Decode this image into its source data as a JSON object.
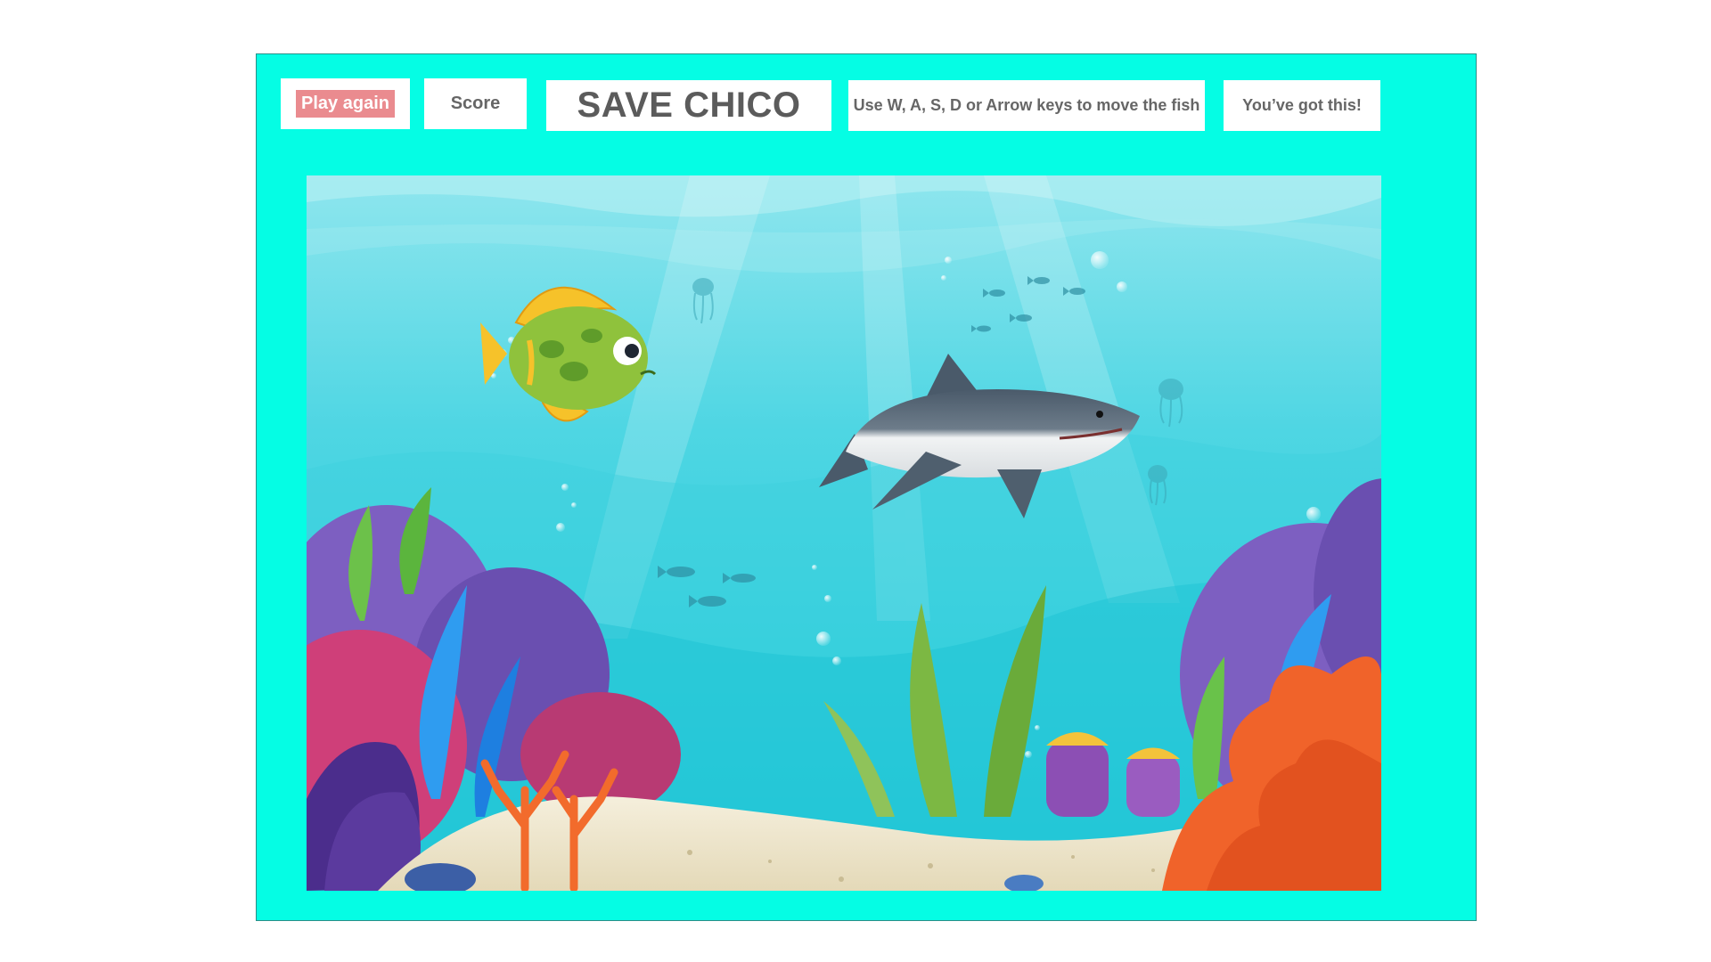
{
  "header": {
    "play_again_label": "Play again",
    "score_label": "Score",
    "title": "SAVE CHICO",
    "instructions": "Use W, A, S, D or Arrow keys to move the fish",
    "encouragement": "You’ve got this!"
  },
  "colors": {
    "frame_background": "#05fde4",
    "play_again_background": "#ea8b8f",
    "water_top": "#8fe6ee",
    "water_bottom": "#15c8d6",
    "sand": "#efe7cf"
  },
  "scene": {
    "player": "yellow-green tropical fish (Chico)",
    "enemy": "great white shark"
  }
}
